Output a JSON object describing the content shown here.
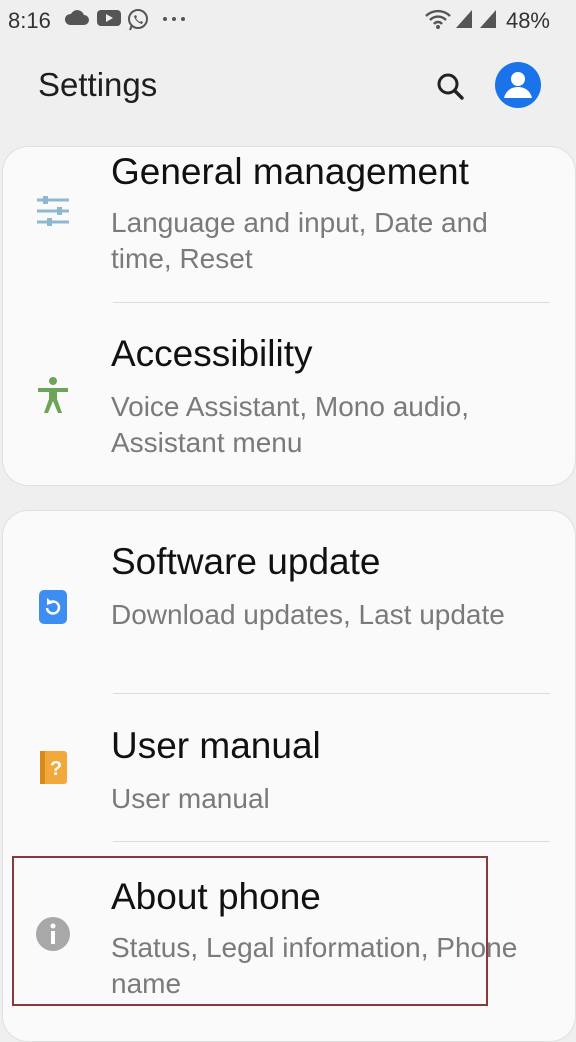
{
  "status_bar": {
    "time": "8:16",
    "left_icons": [
      "cloud-icon",
      "youtube-icon",
      "whatsapp-icon",
      "more-dots-icon"
    ],
    "right_icons": [
      "wifi-icon",
      "signal-icon",
      "signal-icon"
    ],
    "battery": "48%"
  },
  "header": {
    "title": "Settings",
    "search_icon": "search-icon",
    "profile_icon": "account-icon"
  },
  "cards": [
    {
      "items": [
        {
          "title": "General management",
          "subtitle": "Language and input, Date and time, Reset",
          "icon": "sliders-icon",
          "icon_color": "#8fb7d0"
        },
        {
          "title": "Accessibility",
          "subtitle": "Voice Assistant, Mono audio, Assistant menu",
          "icon": "accessibility-icon",
          "icon_color": "#6ea45a"
        }
      ]
    },
    {
      "items": [
        {
          "title": "Software update",
          "subtitle": "Download updates, Last update",
          "icon": "software-update-icon",
          "icon_color": "#3d8ef0"
        },
        {
          "title": "User manual",
          "subtitle": "User manual",
          "icon": "user-manual-icon",
          "icon_color": "#f2a93b"
        },
        {
          "title": "About phone",
          "subtitle": "Status, Legal information, Phone name",
          "icon": "info-icon",
          "icon_color": "#a8a8a8"
        }
      ]
    }
  ],
  "colors": {
    "accent": "#1a73e8",
    "highlight_border": "#8b3a3a",
    "background": "#efefef"
  }
}
